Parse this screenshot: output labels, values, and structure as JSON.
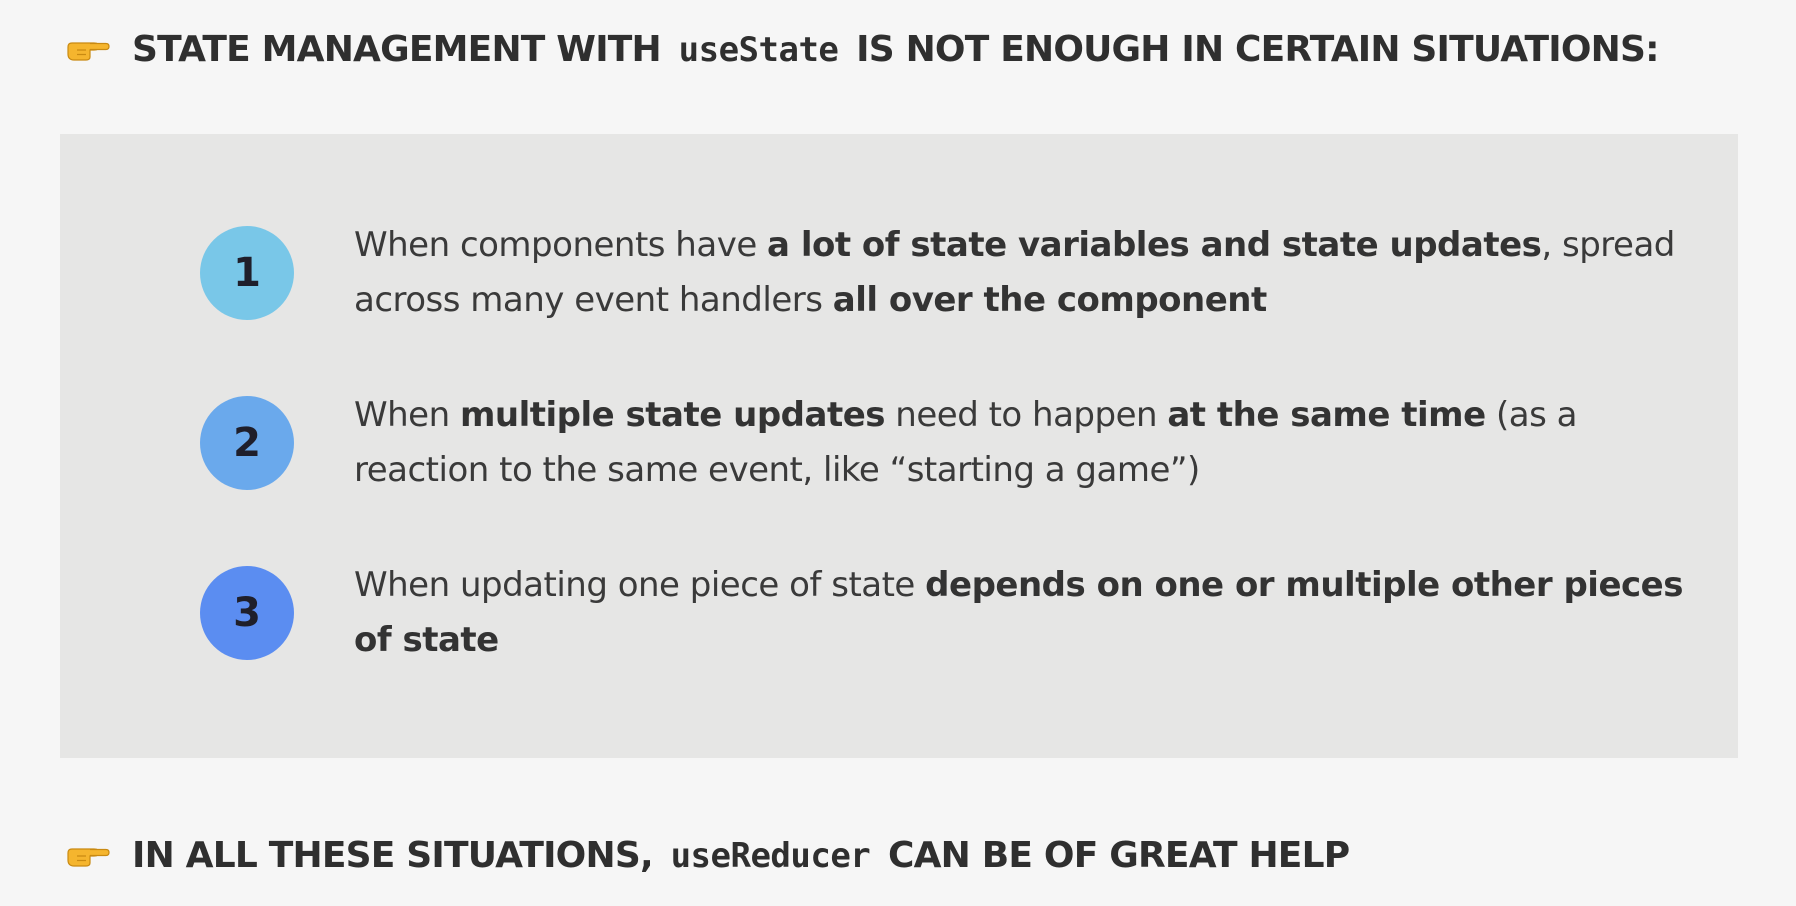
{
  "header": {
    "icon": "pointing-hand-icon",
    "prefix": "STATE MANAGEMENT WITH",
    "code": "useState",
    "suffix": "IS NOT ENOUGH IN CERTAIN SITUATIONS:"
  },
  "items": [
    {
      "number": "1",
      "color": "#79c7e8",
      "t1": "When components have ",
      "b1": "a lot of state variables and state updates",
      "t2": ", spread across many event handlers ",
      "b2": "all over the component"
    },
    {
      "number": "2",
      "color": "#6aa9ec",
      "t1": "When ",
      "b1": "multiple state updates",
      "t2": " need to happen ",
      "b2": "at the same time",
      "t3": " (as a reaction to the same event, like “starting a game”)"
    },
    {
      "number": "3",
      "color": "#5b8df1",
      "t1": "When updating one piece of state ",
      "b1": "depends on one or multiple other pieces of state"
    }
  ],
  "footer": {
    "icon": "pointing-hand-icon",
    "prefix": "IN ALL THESE SITUATIONS,",
    "code": "useReducer",
    "suffix": "CAN BE OF GREAT HELP"
  },
  "colors": {
    "background": "#f6f6f6",
    "panel": "#e6e6e5",
    "text": "#333333"
  }
}
